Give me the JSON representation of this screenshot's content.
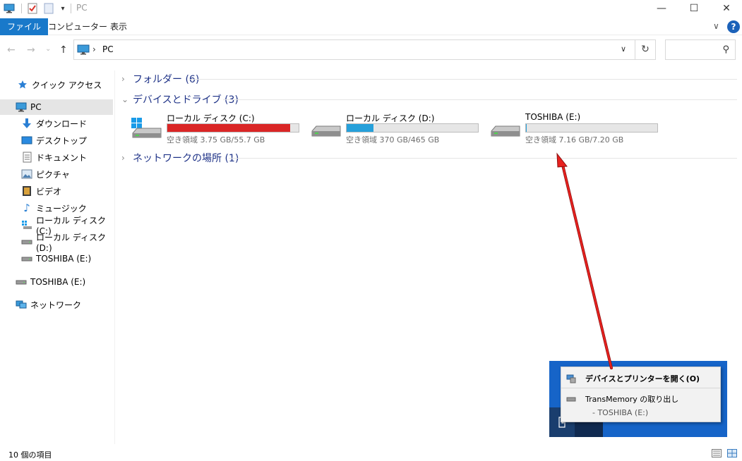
{
  "window": {
    "title": "PC",
    "minimize_glyph": "—",
    "maximize_glyph": "☐",
    "close_glyph": "✕"
  },
  "ribbon": {
    "tabs": [
      {
        "label": "ファイル",
        "active": true
      },
      {
        "label": "コンピューター",
        "active": false
      },
      {
        "label": "表示",
        "active": false
      }
    ],
    "expand_glyph": "∨",
    "help_glyph": "?"
  },
  "navigation": {
    "back_glyph": "←",
    "forward_glyph": "→",
    "recent_glyph": "⌄",
    "up_glyph": "↑",
    "breadcrumb_sep": "›",
    "address": "PC",
    "address_dropdown_glyph": "∨",
    "refresh_glyph": "↻",
    "search_placeholder": "",
    "search_glyph": "⚲"
  },
  "sidebar": {
    "items": [
      {
        "label": "クイック アクセス",
        "icon": "star-icon"
      },
      {
        "label": "PC",
        "icon": "pc-icon",
        "selected": true
      },
      {
        "label": "ダウンロード",
        "icon": "download-icon"
      },
      {
        "label": "デスクトップ",
        "icon": "desktop-icon"
      },
      {
        "label": "ドキュメント",
        "icon": "document-icon"
      },
      {
        "label": "ピクチャ",
        "icon": "picture-icon"
      },
      {
        "label": "ビデオ",
        "icon": "video-icon"
      },
      {
        "label": "ミュージック",
        "icon": "music-icon"
      },
      {
        "label": "ローカル ディスク (C:)",
        "icon": "windows-drive-icon"
      },
      {
        "label": "ローカル ディスク (D:)",
        "icon": "drive-icon"
      },
      {
        "label": "TOSHIBA (E:)",
        "icon": "usb-drive-icon"
      },
      {
        "label": "TOSHIBA (E:)",
        "icon": "usb-drive-icon"
      },
      {
        "label": "ネットワーク",
        "icon": "network-icon"
      }
    ]
  },
  "main": {
    "groups": [
      {
        "label": "フォルダー (6)",
        "expanded": false
      },
      {
        "label": "デバイスとドライブ (3)",
        "expanded": true
      },
      {
        "label": "ネットワークの場所 (1)",
        "expanded": false
      }
    ],
    "drives": [
      {
        "name": "ローカル ディスク (C:)",
        "free": "空き領域 3.75 GB/55.7 GB",
        "used_fraction": 0.933,
        "bar_color": "#da2626",
        "icon": "windows-drive-icon"
      },
      {
        "name": "ローカル ディスク (D:)",
        "free": "空き領域 370 GB/465 GB",
        "used_fraction": 0.204,
        "bar_color": "#26a0da",
        "icon": "drive-icon"
      },
      {
        "name": "TOSHIBA (E:)",
        "free": "空き領域 7.16 GB/7.20 GB",
        "used_fraction": 0.006,
        "bar_color": "#26a0da",
        "icon": "usb-drive-icon"
      }
    ]
  },
  "status": {
    "item_count": "10 個の項目"
  },
  "popup": {
    "open_devices_label": "デバイスとプリンターを開く(O)",
    "eject_label": "TransMemory の取り出し",
    "eject_sub_label": "-   TOSHIBA (E:)"
  },
  "colors": {
    "accent": "#1979ca",
    "group_header": "#1e3287",
    "arrow": "#e8211e",
    "taskbar": "#1664c8"
  }
}
